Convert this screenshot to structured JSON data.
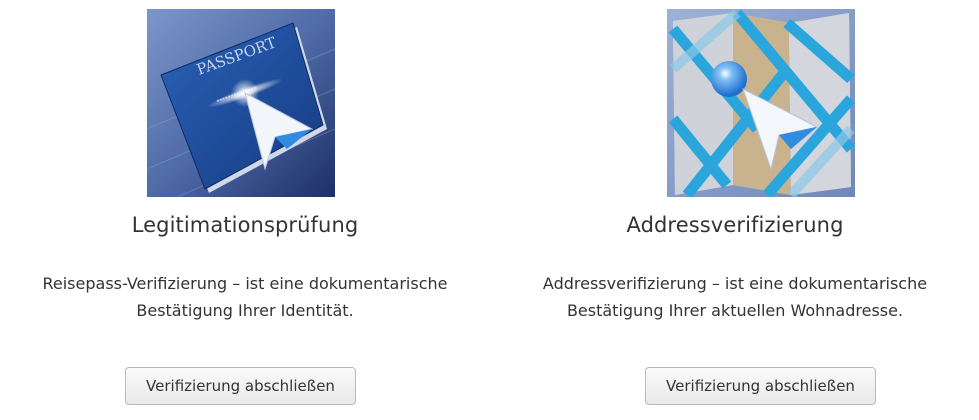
{
  "cards": [
    {
      "icon": "passport-icon",
      "passport_text": "PASSPORT",
      "title": "Legitimationsprüfung",
      "desc_line1": "Reisepass-Verifizierung – ist eine dokumentarische",
      "desc_line2": "Bestätigung Ihrer Identität.",
      "button_label": "Verifizierung abschließen"
    },
    {
      "icon": "map-icon",
      "title": "Addressverifizierung",
      "desc_line1": "Addressverifizierung – ist eine dokumentarische",
      "desc_line2": "Bestätigung Ihrer aktuellen Wohnadresse.",
      "button_label": "Verifizierung abschließen"
    }
  ],
  "colors": {
    "passport_blue": "#1d4f9c",
    "map_cyan": "#29a3d9",
    "cursor_blue": "#2f8ce0",
    "text": "#333333"
  }
}
